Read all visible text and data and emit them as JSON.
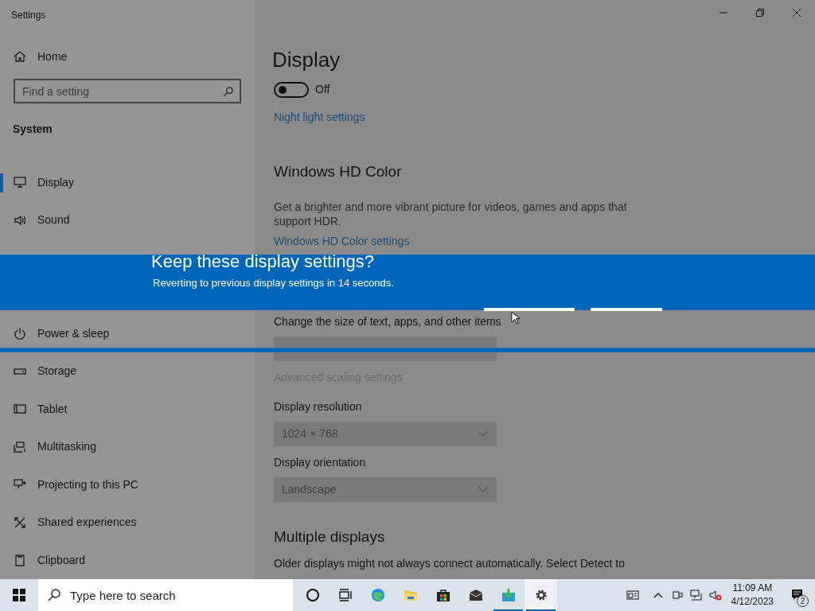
{
  "window": {
    "title": "Settings"
  },
  "sidebar": {
    "home": "Home",
    "search": {
      "placeholder": "Find a setting"
    },
    "section": "System",
    "items": [
      {
        "label": "Display",
        "selected": true
      },
      {
        "label": "Sound",
        "selected": false
      }
    ],
    "items_below_dialog": [
      {
        "label": "Power & sleep",
        "selected": false
      },
      {
        "label": "Storage",
        "selected": false
      },
      {
        "label": "Tablet",
        "selected": false
      },
      {
        "label": "Multitasking",
        "selected": false
      },
      {
        "label": "Projecting to this PC",
        "selected": false
      },
      {
        "label": "Shared experiences",
        "selected": false
      },
      {
        "label": "Clipboard",
        "selected": false
      }
    ]
  },
  "content": {
    "heading": "Display",
    "toggle": {
      "on": false,
      "label": "Off"
    },
    "night_light_link": "Night light settings",
    "hd_color": {
      "heading": "Windows HD Color",
      "description": "Get a brighter and more vibrant picture for videos, games and apps that support HDR.",
      "link": "Windows HD Color settings"
    },
    "scale": {
      "label": "Change the size of text, apps, and other items",
      "disabled": true
    },
    "advanced_link": {
      "text": "Advanced scaling settings",
      "disabled": true
    },
    "resolution": {
      "label": "Display resolution",
      "value": "1024 × 768",
      "disabled": true
    },
    "orientation": {
      "label": "Display orientation",
      "value": "Landscape",
      "disabled": true
    },
    "multiple": {
      "heading": "Multiple displays",
      "description": "Older displays might not always connect automatically. Select Detect to"
    }
  },
  "dialog": {
    "title": "Keep these display settings?",
    "message": "Reverting to previous display settings in 14 seconds."
  },
  "taskbar": {
    "search": {
      "placeholder": "Type here to search"
    },
    "apps": [
      {
        "running": false,
        "focused": false
      },
      {
        "running": false,
        "focused": false
      },
      {
        "running": false,
        "focused": false
      },
      {
        "running": false,
        "focused": false
      },
      {
        "running": false,
        "focused": false
      },
      {
        "running": false,
        "focused": false
      },
      {
        "running": true,
        "focused": false
      },
      {
        "running": true,
        "focused": true
      }
    ],
    "clock": {
      "time": "11:09 AM",
      "date": "4/12/2023"
    },
    "notifications": "2"
  }
}
